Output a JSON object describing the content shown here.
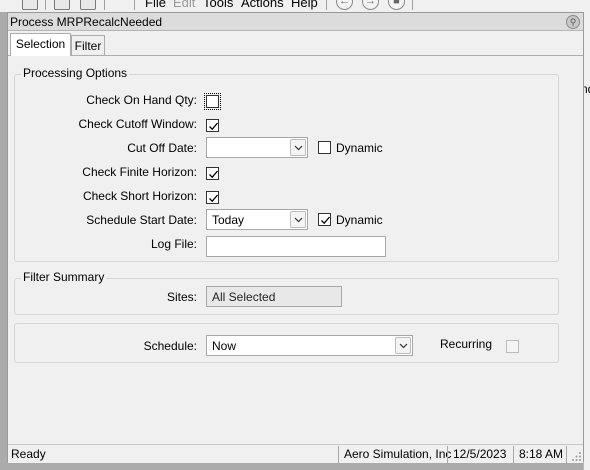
{
  "app_menu": {
    "file": "File",
    "edit": "Edit",
    "tools": "Tools",
    "actions": "Actions",
    "help": "Help"
  },
  "background": {
    "right_edge_text": "nd"
  },
  "window": {
    "title": "Process MRPRecalcNeeded"
  },
  "tabs": [
    {
      "label": "Selection",
      "active": true
    },
    {
      "label": "Filter",
      "active": false
    }
  ],
  "processing_options": {
    "group_label": "Processing Options",
    "check_on_hand_qty": {
      "label": "Check On Hand Qty:",
      "checked": false
    },
    "check_cutoff_window": {
      "label": "Check Cutoff Window:",
      "checked": true
    },
    "cut_off_date": {
      "label": "Cut Off Date:",
      "value": "",
      "dynamic_label": "Dynamic",
      "dynamic_checked": false
    },
    "check_finite_horizon": {
      "label": "Check Finite Horizon:",
      "checked": true
    },
    "check_short_horizon": {
      "label": "Check Short Horizon:",
      "checked": true
    },
    "schedule_start_date": {
      "label": "Schedule Start Date:",
      "value": "Today",
      "dynamic_label": "Dynamic",
      "dynamic_checked": true
    },
    "log_file": {
      "label": "Log File:",
      "value": ""
    }
  },
  "filter_summary": {
    "group_label": "Filter Summary",
    "sites_label": "Sites:",
    "sites_value": "All Selected"
  },
  "schedule": {
    "label": "Schedule:",
    "value": "Now",
    "recurring_label": "Recurring",
    "recurring_checked": false
  },
  "status_bar": {
    "status": "Ready",
    "company": "Aero Simulation, Inc",
    "date": "12/5/2023",
    "time": "8:18 AM"
  }
}
